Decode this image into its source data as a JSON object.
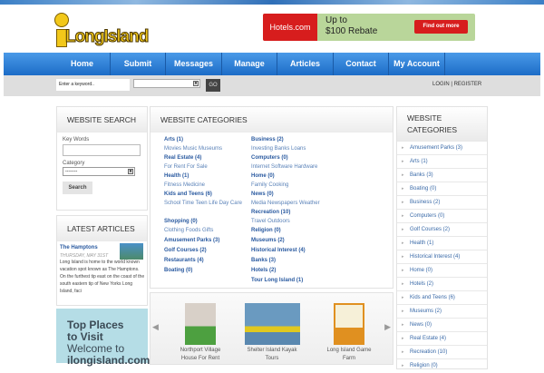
{
  "logo": {
    "text": "LongIsland"
  },
  "ad": {
    "brand": "Hotels.com",
    "line1": "Up to",
    "line2": "$100 Rebate",
    "button": "Find out more"
  },
  "nav": [
    "Home",
    "Submit",
    "Messages",
    "Manage",
    "Articles",
    "Contact",
    "My Account"
  ],
  "searchbar": {
    "placeholder": "Enter a keyword..",
    "go": "GO",
    "login": "LOGIN | REGISTER"
  },
  "website_search": {
    "title": "WEBSITE SEARCH",
    "keywords_label": "Key Words",
    "category_label": "Category",
    "category_value": "--------",
    "button": "Search"
  },
  "latest_articles": {
    "title": "LATEST ARTICLES",
    "article_title": "The Hamptons",
    "date": "THURSDAY, MAY 31ST",
    "excerpt": "Long Island is home to the world known vacation spot known as The Hamptons. On the furthest tip east on the coast of the south eastern tip of New Yorks Long Island, faci"
  },
  "promo": {
    "line1": "Top Places",
    "line2": "to Visit",
    "line3": "Welcome to",
    "line4": "ilongisland.com"
  },
  "categories": {
    "title": "WEBSITE CATEGORIES",
    "left": [
      {
        "h": "Arts (1)",
        "s": "Movies Music Museums"
      },
      {
        "h": "Real Estate (4)",
        "s": "For Rent For Sale"
      },
      {
        "h": "Health (1)",
        "s": "Fitness Medicine"
      },
      {
        "h": "Kids and Teens (6)",
        "s": "School Time Teen Life Day Care"
      },
      {
        "h": "Shopping (0)",
        "s": "Clothing Foods Gifts"
      },
      {
        "h": "Amusement Parks (3)"
      },
      {
        "h": "Golf Courses (2)"
      },
      {
        "h": "Restaurants (4)"
      },
      {
        "h": "Boating (0)"
      }
    ],
    "right": [
      {
        "h": "Business (2)",
        "s": "Investing Banks Loans"
      },
      {
        "h": "Computers (0)",
        "s": "Internet Software Hardware"
      },
      {
        "h": "Home (0)",
        "s": "Family Cooking"
      },
      {
        "h": "News (0)",
        "s": "Media Newspapers Weather"
      },
      {
        "h": "Recreation (10)",
        "s": "Travel Outdoors"
      },
      {
        "h": "Religion (0)"
      },
      {
        "h": "Museums (2)"
      },
      {
        "h": "Historical Interest (4)"
      },
      {
        "h": "Banks (3)"
      },
      {
        "h": "Hotels (2)"
      },
      {
        "h": "Tour Long Island (1)"
      }
    ]
  },
  "sidebar": {
    "title1": "WEBSITE",
    "title2": "CATEGORIES",
    "items": [
      "Amusement Parks (3)",
      "Arts (1)",
      "Banks (3)",
      "Boating (0)",
      "Business (2)",
      "Computers (0)",
      "Golf Courses (2)",
      "Health (1)",
      "Historical Interest (4)",
      "Home (0)",
      "Hotels (2)",
      "Kids and Teens (6)",
      "Museums (2)",
      "News (0)",
      "Real Estate (4)",
      "Recreation (10)",
      "Religion (0)"
    ]
  },
  "carousel": [
    {
      "l1": "Northport Village",
      "l2": "House For Rent"
    },
    {
      "l1": "Shelter Island Kayak",
      "l2": "Tours"
    },
    {
      "l1": "Long Island Game",
      "l2": "Farm"
    }
  ]
}
